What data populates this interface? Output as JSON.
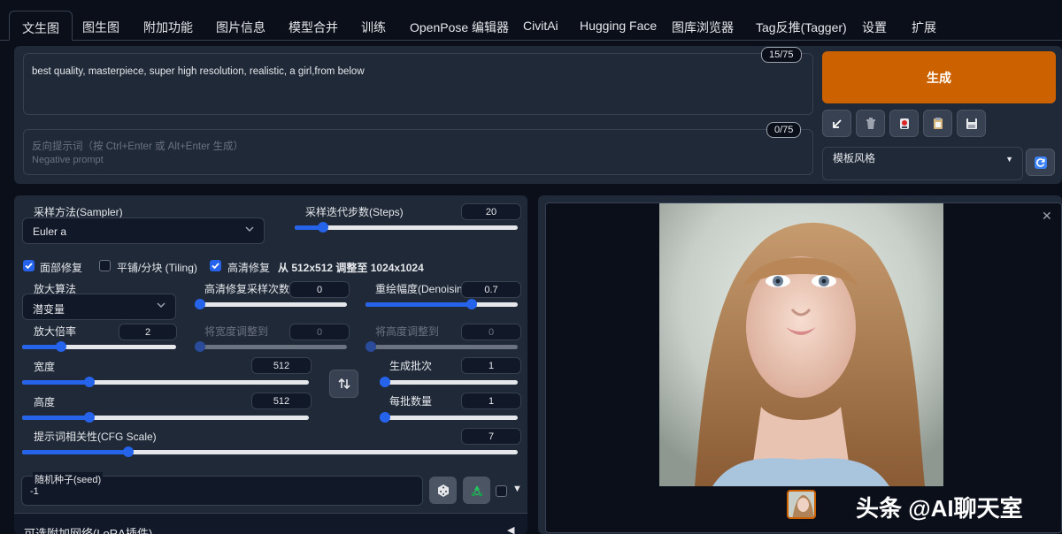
{
  "tabs": [
    "文生图",
    "图生图",
    "附加功能",
    "图片信息",
    "模型合并",
    "训练",
    "OpenPose 编辑器",
    "CivitAi",
    "Hugging Face",
    "图库浏览器",
    "Tag反推(Tagger)",
    "设置",
    "扩展"
  ],
  "prompt": {
    "text": "best quality, masterpiece, super high resolution, realistic, a girl,from below",
    "counter": "15/75"
  },
  "negative": {
    "placeholder_line1": "反向提示词（按 Ctrl+Enter 或 Alt+Enter 生成）",
    "placeholder_line2": "Negative prompt",
    "counter": "0/75"
  },
  "generate_label": "生成",
  "tool_icons": [
    "arrow-down-left-icon",
    "trash-icon",
    "red-card-icon",
    "clipboard-icon",
    "save-icon"
  ],
  "style": {
    "label": "模板风格"
  },
  "sampler": {
    "label": "采样方法(Sampler)",
    "value": "Euler a"
  },
  "steps": {
    "label": "采样迭代步数(Steps)",
    "value": "20",
    "min": 1,
    "max": 150,
    "level": 20
  },
  "checks": {
    "face_restore": {
      "label": "面部修复",
      "checked": true
    },
    "tiling": {
      "label": "平铺/分块 (Tiling)",
      "checked": false
    },
    "hires": {
      "label": "高清修复",
      "checked": true
    },
    "hires_info": "从 512x512 调整至 1024x1024"
  },
  "upscaler": {
    "label": "放大算法",
    "value": "潜变量"
  },
  "hires_steps": {
    "label": "高清修复采样次数",
    "value": "0",
    "level": 0
  },
  "denoise": {
    "label": "重绘幅度(Denoising)",
    "value": "0.7",
    "level": 0.7
  },
  "upscale_by": {
    "label": "放大倍率",
    "value": "2",
    "level": 0.25
  },
  "resize_w": {
    "label": "将宽度调整到",
    "value": "0",
    "level": 0
  },
  "resize_h": {
    "label": "将高度调整到",
    "value": "0",
    "level": 0
  },
  "width": {
    "label": "宽度",
    "value": "512",
    "level": 0.235
  },
  "height": {
    "label": "高度",
    "value": "512",
    "level": 0.235
  },
  "batch_count": {
    "label": "生成批次",
    "value": "1",
    "level": 0
  },
  "batch_size": {
    "label": "每批数量",
    "value": "1",
    "level": 0
  },
  "cfg": {
    "label": "提示词相关性(CFG Scale)",
    "value": "7",
    "level": 0.215
  },
  "seed": {
    "label": "随机种子(seed)",
    "value": "-1"
  },
  "lora": {
    "label": "可选附加网络(LoRA插件)"
  },
  "gallery": {
    "watermark": "头条 @AI聊天室"
  },
  "colors": {
    "accent": "#cc6100",
    "slider": "#2563eb",
    "panel": "#1f2937",
    "background": "#0b0f19"
  }
}
